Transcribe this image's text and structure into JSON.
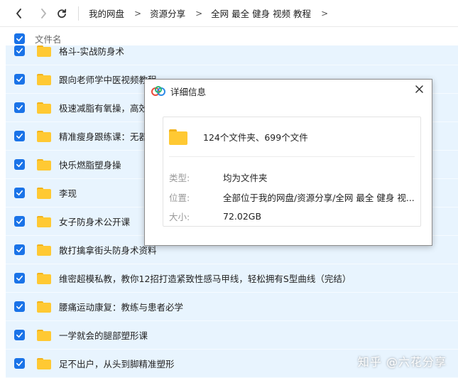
{
  "navbar": {
    "breadcrumbs": [
      "我的网盘",
      "资源分享",
      "全网 最全 健身 视频 教程"
    ],
    "separator": ">"
  },
  "list_header": {
    "label": "文件名"
  },
  "rows": [
    {
      "name": "格斗-实战防身术"
    },
    {
      "name": "跟向老师学中医视频教程"
    },
    {
      "name": "极速减脂有氧操，高效燃"
    },
    {
      "name": "精准瘦身跟练课：无器械"
    },
    {
      "name": "快乐燃脂塑身操"
    },
    {
      "name": "李现"
    },
    {
      "name": "女子防身术公开课"
    },
    {
      "name": "散打擒拿街头防身术资料"
    },
    {
      "name": "维密超模私教，教你12招打造紧致性感马甲线，轻松拥有S型曲线（完结）"
    },
    {
      "name": "腰痛运动康复：教练与患者必学"
    },
    {
      "name": "一学就会的腿部塑形课"
    },
    {
      "name": "足不出户，从头到脚精准塑形"
    }
  ],
  "dialog": {
    "title": "详细信息",
    "summary": "124个文件夹、699个文件",
    "type_label": "类型:",
    "type_value": "均为文件夹",
    "location_label": "位置:",
    "location_value": "全部位于我的网盘/资源分享/全网 最全 健身 视...",
    "size_label": "大小:",
    "size_value": "72.02GB"
  },
  "watermark": "知乎 @六花分享",
  "colors": {
    "accent": "#1a73e8",
    "row_bg": "#e8f4fe",
    "folder": "#ffc933"
  }
}
